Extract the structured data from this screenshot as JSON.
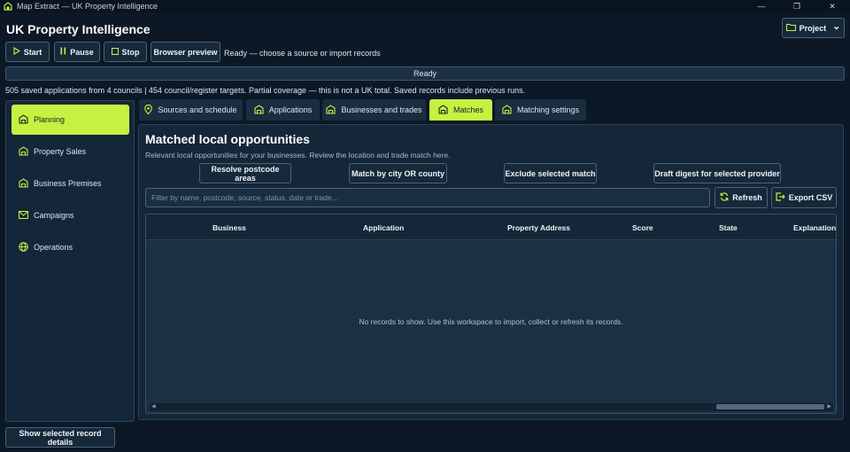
{
  "window": {
    "title": "Map Extract — UK Property Intelligence",
    "minimize": "—",
    "maximize": "❐",
    "close": "✕"
  },
  "app_title": "UK Property Intelligence",
  "project_button": {
    "label": "Project",
    "chevron": "⌄"
  },
  "toolbar": {
    "start_label": "Start",
    "pause_label": "Pause",
    "stop_label": "Stop",
    "preview_label": "Browser preview",
    "status": "Ready — choose a source or import records"
  },
  "progress": {
    "label": "Ready"
  },
  "coverage_text": "505 saved applications from 4 councils | 454 council/register targets. Partial coverage — this is not a UK total. Saved records include previous runs.",
  "sidebar": {
    "items": [
      {
        "label": "Planning",
        "icon": "building-icon",
        "active": true
      },
      {
        "label": "Property Sales",
        "icon": "building-icon",
        "active": false
      },
      {
        "label": "Business Premises",
        "icon": "building-icon",
        "active": false
      },
      {
        "label": "Campaigns",
        "icon": "mail-icon",
        "active": false
      },
      {
        "label": "Operations",
        "icon": "globe-icon",
        "active": false
      }
    ]
  },
  "tabs": [
    {
      "label": "Sources and schedule",
      "icon": "map-pin-icon",
      "active": false
    },
    {
      "label": "Applications",
      "icon": "building-icon",
      "active": false
    },
    {
      "label": "Businesses and trades",
      "icon": "building-icon",
      "active": false
    },
    {
      "label": "Matches",
      "icon": "building-icon",
      "active": true
    },
    {
      "label": "Matching settings",
      "icon": "building-icon",
      "active": false
    }
  ],
  "panel": {
    "title": "Matched local opportunities",
    "subtitle": "Relevant local opportunities for your businesses. Review the location and trade match here.",
    "actions": {
      "resolve": "Resolve postcode areas",
      "match": "Match by city OR county",
      "exclude": "Exclude selected match",
      "draft": "Draft digest for selected provider"
    },
    "filter_placeholder": "Filter by name, postcode, source, status, date or trade...",
    "refresh_label": "Refresh",
    "export_label": "Export CSV",
    "columns": {
      "business": "Business",
      "application": "Application",
      "address": "Property Address",
      "score": "Score",
      "state": "State",
      "explanation": "Explanation"
    },
    "empty_message": "No records to show. Use this workspace to import, collect or refresh its records."
  },
  "details_button": "Show selected record details",
  "colors": {
    "accent": "#c5f240",
    "background": "#0c1826",
    "panel": "#142638",
    "border": "#4a6277"
  }
}
